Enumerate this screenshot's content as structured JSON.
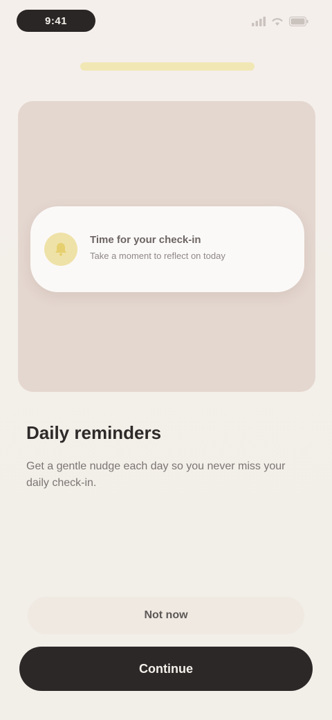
{
  "status_bar": {
    "time": "9:41",
    "icons": [
      "signal-icon",
      "wifi-icon",
      "battery-icon"
    ]
  },
  "progress": {
    "fraction": 1.0
  },
  "illustration": {
    "notification": {
      "icon": "bell-icon",
      "title": "Time for your check-in",
      "body": "Take a moment to reflect on today"
    }
  },
  "content": {
    "title": "Daily reminders",
    "description": "Get a gentle nudge each day so you never miss your daily check-in."
  },
  "actions": {
    "secondary_label": "Not now",
    "primary_label": "Continue"
  },
  "colors": {
    "background": "#f3efe9",
    "illustration_bg": "#e4d7cf",
    "accent_yellow": "#f1e7b4",
    "primary_button": "#2c2828"
  }
}
